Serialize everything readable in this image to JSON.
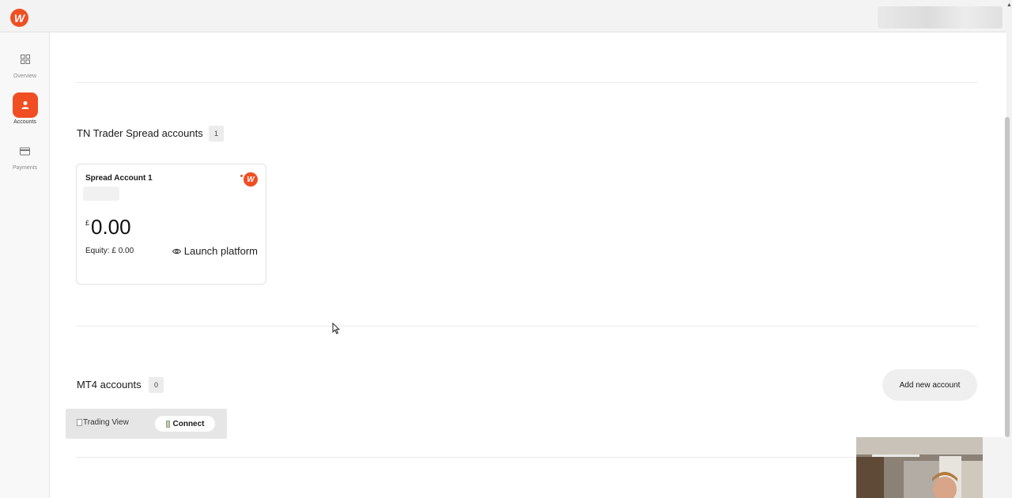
{
  "brand": {
    "logo_icon": "tn-logo-icon",
    "accent_color": "#f04e23"
  },
  "sidebar": {
    "items": [
      {
        "label": "Overview",
        "icon": "grid-icon",
        "active": false
      },
      {
        "label": "Accounts",
        "icon": "user-icon",
        "active": true
      },
      {
        "label": "Payments",
        "icon": "card-icon",
        "active": false
      }
    ]
  },
  "spread_section": {
    "title": "TN Trader Spread accounts",
    "count": "1",
    "card": {
      "title": "Spread Account 1",
      "currency": "£",
      "balance": "0.00",
      "equity": "Equity: £ 0.00",
      "launch_label": "Launch platform"
    }
  },
  "mt4_section": {
    "title": "MT4 accounts",
    "count": "0",
    "add_label": "Add new account"
  },
  "trading_view": {
    "image_alt": "Trading View",
    "connect_label": "Connect"
  }
}
